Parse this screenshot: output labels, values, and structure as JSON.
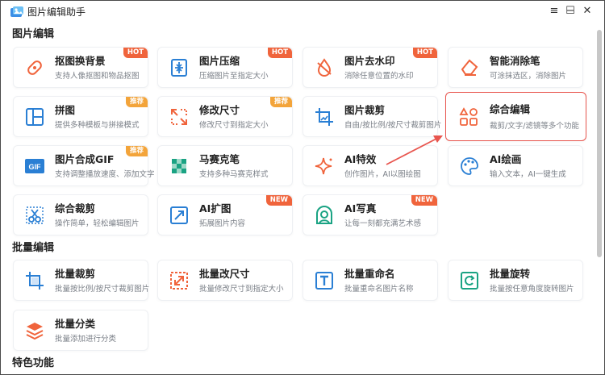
{
  "app": {
    "title": "图片编辑助手"
  },
  "window_controls": {
    "menu": "≡",
    "minimize": "−",
    "maximize": "☐",
    "close": "✕"
  },
  "sections": {
    "image_edit": "图片编辑",
    "batch_edit": "批量编辑",
    "special": "特色功能"
  },
  "image_edit_cards": [
    {
      "title": "抠图换背景",
      "desc": "支持人像抠图和物品抠图",
      "badge": "HOT",
      "icon": "cutout-icon"
    },
    {
      "title": "图片压缩",
      "desc": "压缩图片至指定大小",
      "badge": "HOT",
      "icon": "compress-icon"
    },
    {
      "title": "图片去水印",
      "desc": "消除任意位置的水印",
      "badge": "HOT",
      "icon": "watermark-remove-icon"
    },
    {
      "title": "智能消除笔",
      "desc": "可涂抹选区，消除图片",
      "badge": "",
      "icon": "eraser-icon"
    },
    {
      "title": "拼图",
      "desc": "提供多种模板与拼接模式",
      "badge": "推荐",
      "icon": "collage-icon"
    },
    {
      "title": "修改尺寸",
      "desc": "修改尺寸到指定大小",
      "badge": "推荐",
      "icon": "resize-icon"
    },
    {
      "title": "图片裁剪",
      "desc": "自由/按比例/按尺寸裁剪图片",
      "badge": "",
      "icon": "crop-icon"
    },
    {
      "title": "综合编辑",
      "desc": "裁剪/文字/滤镜等多个功能",
      "badge": "",
      "icon": "shapes-icon"
    },
    {
      "title": "图片合成GIF",
      "desc": "支持调整播放速度、添加文字",
      "badge": "推荐",
      "icon": "gif-icon"
    },
    {
      "title": "马赛克笔",
      "desc": "支持多种马赛克样式",
      "badge": "",
      "icon": "mosaic-icon"
    },
    {
      "title": "AI特效",
      "desc": "创作图片，AI以图绘图",
      "badge": "",
      "icon": "sparkle-icon"
    },
    {
      "title": "AI绘画",
      "desc": "输入文本，AI一键生成",
      "badge": "",
      "icon": "palette-icon"
    },
    {
      "title": "综合裁剪",
      "desc": "操作简单，轻松编辑图片",
      "badge": "",
      "icon": "scissors-icon"
    },
    {
      "title": "AI扩图",
      "desc": "拓展图片内容",
      "badge": "NEW",
      "icon": "expand-icon"
    },
    {
      "title": "AI写真",
      "desc": "让每一刻都充满艺术感",
      "badge": "NEW",
      "icon": "portrait-icon"
    }
  ],
  "batch_cards": [
    {
      "title": "批量裁剪",
      "desc": "批量按比例/按尺寸裁剪图片",
      "icon": "batch-crop-icon"
    },
    {
      "title": "批量改尺寸",
      "desc": "批量修改尺寸到指定大小",
      "icon": "batch-resize-icon"
    },
    {
      "title": "批量重命名",
      "desc": "批量重命名图片名称",
      "icon": "batch-rename-icon"
    },
    {
      "title": "批量旋转",
      "desc": "批量按任意角度旋转图片",
      "icon": "batch-rotate-icon"
    },
    {
      "title": "批量分类",
      "desc": "批量添加进行分类",
      "icon": "batch-classify-icon"
    }
  ],
  "colors": {
    "accent": "#e8554e",
    "hot": "#f0643c",
    "recommend": "#f3a43a",
    "icon_blue": "#2a7fd4"
  }
}
